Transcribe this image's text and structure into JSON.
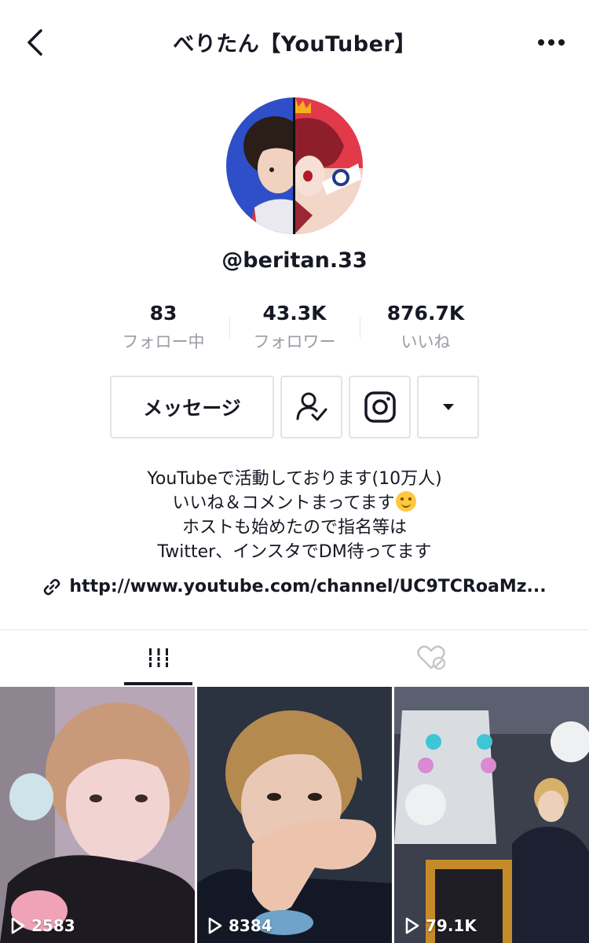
{
  "header": {
    "title": "べりたん【YouTuber】",
    "back_icon": "chevron-left-icon",
    "more_icon": "more-horizontal-icon"
  },
  "profile": {
    "username": "@beritan.33"
  },
  "stats": [
    {
      "value": "83",
      "label": "フォロー中"
    },
    {
      "value": "43.3K",
      "label": "フォロワー"
    },
    {
      "value": "876.7K",
      "label": "いいね"
    }
  ],
  "actions": {
    "message_label": "メッセージ",
    "follow_icon": "user-check-icon",
    "instagram_icon": "instagram-icon",
    "dropdown_icon": "caret-down-icon"
  },
  "bio": {
    "lines": [
      "YouTubeで活動しております(10万人)",
      "いいね＆コメントまってます",
      "ホストも始めたので指名等は",
      "Twitter、インスタでDM待ってます"
    ],
    "link": "http://www.youtube.com/channel/UC9TCRoaMz..."
  },
  "tabs": [
    {
      "name": "videos",
      "icon": "grid-icon",
      "active": true
    },
    {
      "name": "liked",
      "icon": "heart-hidden-icon",
      "active": false
    }
  ],
  "videos": [
    {
      "views": "2583"
    },
    {
      "views": "8384"
    },
    {
      "views": "79.1K"
    }
  ],
  "colors": {
    "text": "#161823",
    "muted": "#9a9ca3",
    "border": "#e3e3e6",
    "avatar_left": "#2f4fc9",
    "avatar_right": "#e23a4a"
  }
}
